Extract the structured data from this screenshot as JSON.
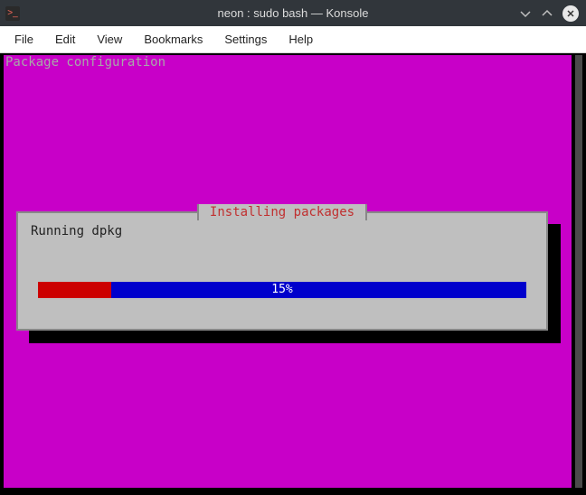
{
  "window": {
    "title": "neon : sudo bash — Konsole",
    "icon_glyph": ">_"
  },
  "menu": {
    "file": "File",
    "edit": "Edit",
    "view": "View",
    "bookmarks": "Bookmarks",
    "settings": "Settings",
    "help": "Help"
  },
  "terminal": {
    "header": "Package configuration",
    "dialog_title": "Installing packages",
    "dialog_status": "Running dpkg",
    "progress_percent": 15,
    "progress_label": "15%"
  },
  "colors": {
    "terminal_bg": "#c800c8",
    "dialog_bg": "#bfbfbf",
    "progress_fill": "#cc0000",
    "progress_track": "#0000cc",
    "dialog_title_color": "#c03030"
  }
}
